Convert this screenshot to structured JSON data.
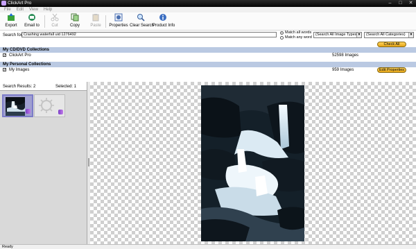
{
  "window": {
    "title": "ClickArt Pro",
    "controls": [
      "–",
      "□",
      "✕"
    ]
  },
  "menu": [
    "File",
    "Edit",
    "View",
    "Help"
  ],
  "toolbar": {
    "export": "Export",
    "email": "Email to",
    "cut": "Cut",
    "copy": "Copy",
    "paste": "Paste",
    "properties": "Properties",
    "clear_search": "Clear Search",
    "product_info": "Product Info"
  },
  "search": {
    "label": "Search for:",
    "value": "Crashing waterfall uid 1276492",
    "match_all": "Match all words",
    "match_any": "Match any word",
    "image_types": "(Search All Image Types)",
    "categories": "(Search All Categories)",
    "check_all": "Check All"
  },
  "collections": {
    "cd_header": "My CD/DVD Collections",
    "cd_name": "ClickArt Pro",
    "cd_count": "52598 Images",
    "personal_header": "My Personal Collections",
    "personal_name": "My Images",
    "personal_count": "959 Images",
    "edit_properties": "Edit Properties"
  },
  "results": {
    "label": "Search Results: 2",
    "selected": "Selected: 1"
  },
  "status": "Ready",
  "colors": {
    "titlebar": "#0d0d0d",
    "collection_header": "#bac9e2",
    "pill_button": "#f2b92a",
    "selected_thumb": "#9f9fd0"
  }
}
